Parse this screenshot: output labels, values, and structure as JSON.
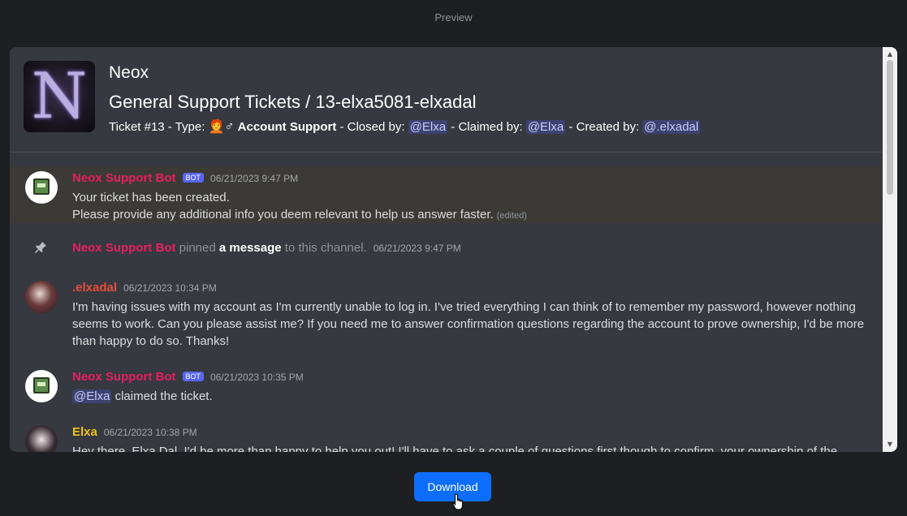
{
  "preview_label": "Preview",
  "header": {
    "guild_name": "Neox",
    "guild_icon_letter": "N",
    "channel_title": "General Support Tickets / 13-elxa5081-elxadal",
    "ticket_prefix": "Ticket #13 - Type: ",
    "ticket_type_emoji": "🧑‍🦰♂",
    "ticket_type": "Account Support",
    "closed_by_label": " - Closed by: ",
    "closed_by": "@Elxa",
    "claimed_by_label": " - Claimed by: ",
    "claimed_by": "@Elxa",
    "created_by_label": " - Created by: ",
    "created_by": "@.elxadal"
  },
  "messages": [
    {
      "author": "Neox Support Bot",
      "tag": "BOT",
      "timestamp": "06/21/2023 9:47 PM",
      "line1": "Your ticket has been created.",
      "line2": "Please provide any additional info you deem relevant to help us answer faster.",
      "edited": "(edited)"
    },
    {
      "author": "Neox Support Bot",
      "pinned_text": " pinned ",
      "link_text": "a message",
      "suffix": " to this channel.",
      "timestamp": "06/21/2023 9:47 PM"
    },
    {
      "author": ".elxadal",
      "timestamp": "06/21/2023 10:34 PM",
      "text": "I'm having issues with my account as I'm currently unable to log in. I've tried everything I can think of to remember my password, however nothing seems to work. Can you please assist me? If you need me to answer confirmation questions regarding the account to prove ownership, I'd be more than happy to do so. Thanks!"
    },
    {
      "author": "Neox Support Bot",
      "tag": "BOT",
      "timestamp": "06/21/2023 10:35 PM",
      "mention": "@Elxa",
      "text": " claimed the ticket."
    },
    {
      "author": "Elxa",
      "timestamp": "06/21/2023 10:38 PM",
      "text": "Hey there, Elxa Dal. I'd be more than happy to help you out! I'll have to ask a couple of questions first though to confirm, your ownership of the"
    }
  ],
  "download_label": "Download",
  "colors": {
    "bot_author": "#e91e63",
    "user_author": "#e74c3c",
    "elxa_author": "#f1c40f",
    "download_button": "#0d6efd"
  }
}
